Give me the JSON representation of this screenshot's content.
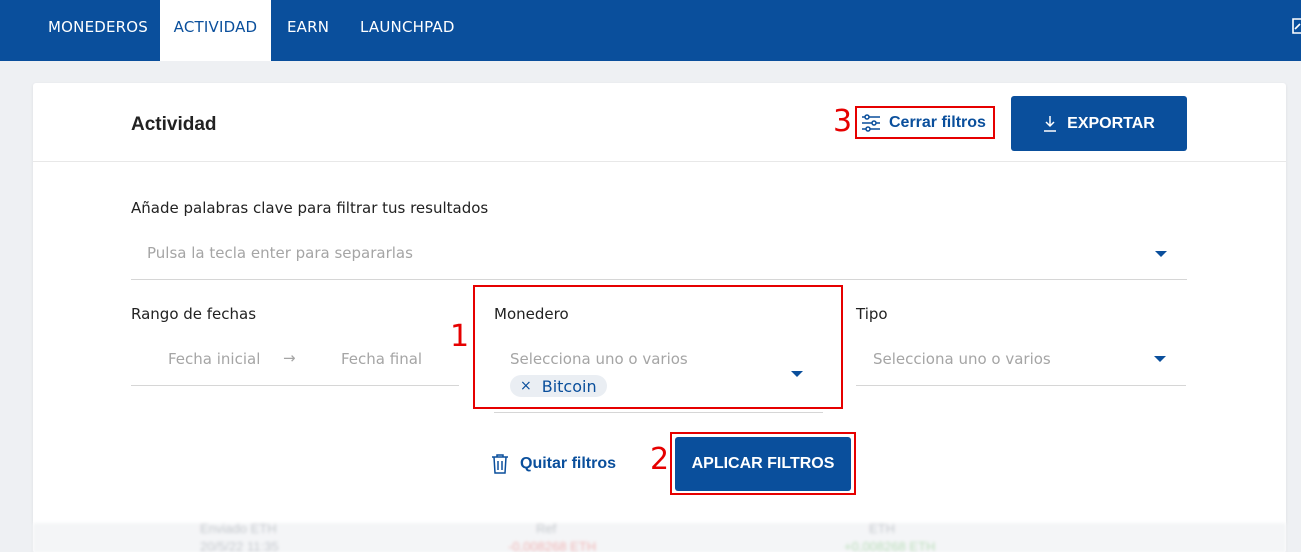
{
  "nav": {
    "items": [
      {
        "label": "MONEDEROS"
      },
      {
        "label": "ACTIVIDAD",
        "active": true
      },
      {
        "label": "EARN"
      },
      {
        "label": "LAUNCHPAD"
      }
    ],
    "right_icon": "logout-icon"
  },
  "header": {
    "title": "Actividad",
    "close_filters_label": "Cerrar filtros",
    "close_filters_icon": "sliders-icon",
    "export_label": "EXPORTAR",
    "export_icon": "download-icon"
  },
  "annotations": {
    "one": "1",
    "two": "2",
    "three": "3"
  },
  "filters": {
    "keywords": {
      "label": "Añade palabras clave para filtrar tus resultados",
      "placeholder": "Pulsa la tecla enter para separarlas"
    },
    "date_range": {
      "label": "Rango de fechas",
      "start_placeholder": "Fecha inicial",
      "arrow": "→",
      "end_placeholder": "Fecha final"
    },
    "wallet": {
      "label": "Monedero",
      "placeholder": "Selecciona uno o varios",
      "selected": [
        "Bitcoin"
      ],
      "remove_glyph": "×"
    },
    "type": {
      "label": "Tipo",
      "placeholder": "Selecciona uno o varios"
    },
    "clear_label": "Quitar filtros",
    "clear_icon": "trash-icon",
    "apply_label": "APLICAR FILTROS"
  },
  "background_rows": [
    {
      "a": "Enviado ETH",
      "b": "20/5/22 11:35",
      "c": "Ref",
      "d": "-0,008268 ETH",
      "e": "ETH",
      "f": "+0,008268 ETH"
    }
  ],
  "colors": {
    "brand": "#0a4f9c",
    "annotation": "#e60000"
  }
}
